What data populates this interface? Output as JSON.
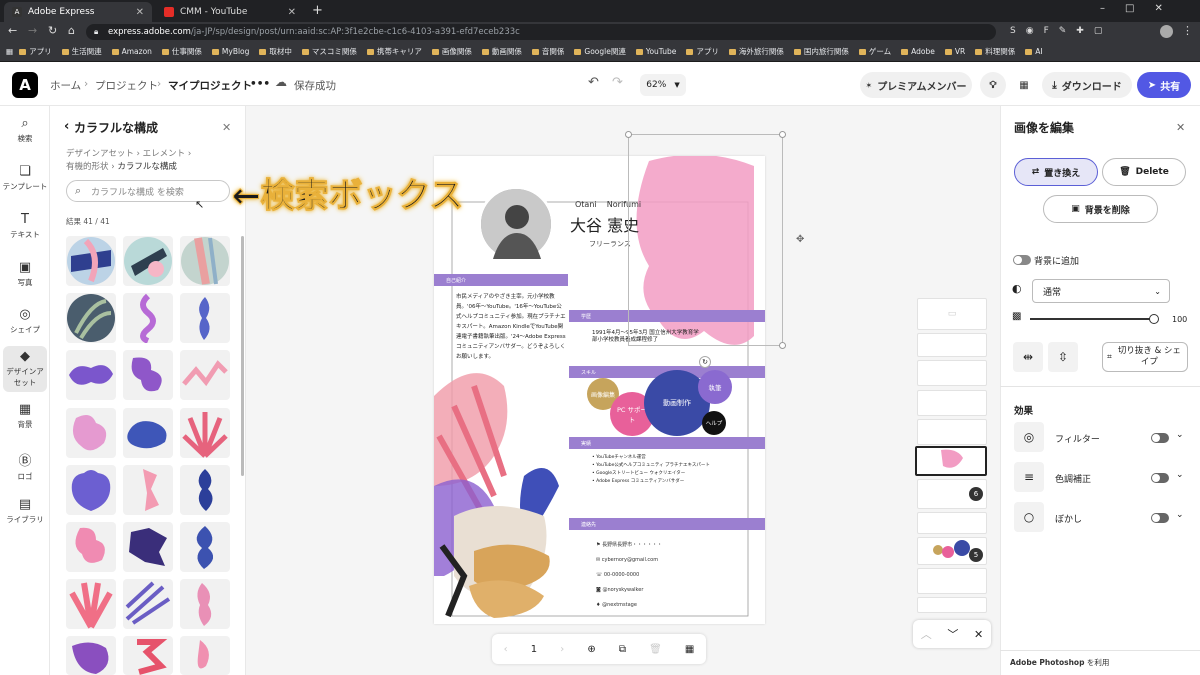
{
  "browser": {
    "tabs": [
      {
        "label": "Adobe Express",
        "active": true
      },
      {
        "label": "CMM - YouTube",
        "active": false
      }
    ],
    "url_host": "express.adobe.com",
    "url_path": "/ja-JP/sp/design/post/urn:aaid:sc:AP:3f1e2cbe-c1c6-4103-a391-efd7eceb233c",
    "bookmarks": [
      "アプリ",
      "生活関連",
      "Amazon",
      "仕事関係",
      "MyBlog",
      "取材中",
      "マスコミ関係",
      "携帯キャリア",
      "画像関係",
      "動画関係",
      "音関係",
      "Google関連",
      "YouTube",
      "アプリ",
      "海外旅行関係",
      "国内旅行関係",
      "ゲーム",
      "Adobe",
      "VR",
      "料理関係",
      "AI"
    ]
  },
  "header": {
    "logo": "A",
    "breadcrumb": [
      "ホーム",
      "プロジェクト",
      "マイプロジェクト"
    ],
    "more": "•••",
    "save_status": "保存成功",
    "zoom": "62%",
    "premium": "プレミアムメンバー",
    "download": "ダウンロード",
    "share": "共有"
  },
  "rail": [
    {
      "icon": "search-icon",
      "glyph": "⌕",
      "label": "検索"
    },
    {
      "icon": "template-icon",
      "glyph": "❏",
      "label": "テンプレート"
    },
    {
      "icon": "text-icon",
      "glyph": "T",
      "label": "テキスト"
    },
    {
      "icon": "photo-icon",
      "glyph": "▣",
      "label": "写真"
    },
    {
      "icon": "shape-icon",
      "glyph": "◎",
      "label": "シェイプ"
    },
    {
      "icon": "design-asset-icon",
      "glyph": "◆",
      "label": "デザインアセット"
    },
    {
      "icon": "background-icon",
      "glyph": "▦",
      "label": "背景"
    },
    {
      "icon": "logo-icon",
      "glyph": "Ⓑ",
      "label": "ロゴ"
    },
    {
      "icon": "library-icon",
      "glyph": "▤",
      "label": "ライブラリ"
    }
  ],
  "panel": {
    "title": "カラフルな構成",
    "crumb1": "デザインアセット",
    "crumb2": "エレメント",
    "crumb3": "有機的形状",
    "crumb4": "カラフルな構成",
    "search_placeholder": "カラフルな構成 を検索",
    "results": "結果 41 / 41"
  },
  "annotation": "←検索ボックス",
  "resume": {
    "name_roman": "Otani    Norifumi",
    "name_jp": "大谷 憲史",
    "title": "フリーランス",
    "section_intro": "自己紹介",
    "intro_text": "市民メディアのやざき主宰。元小学校教員。'06年〜YouTube。'16年〜YouTube公式ヘルプコミュニティ参加。現在プラチナエキスパート。Amazon KindleでYouTube関連電子書籍執筆出版。'24〜Adobe Express コミュニティアンバサダー。どうぞよろしくお願いします。",
    "section_school": "学歴",
    "school_text": "1991年4月〜95年3月 国立信州大学教育学部小学校教員養成課程修了",
    "section_skill": "スキル",
    "skills": [
      "画像編集",
      "PC サポート",
      "動画制作",
      "執筆",
      "ヘルプ"
    ],
    "section_works": "実績",
    "works": [
      "YouTubeチャンネル運営",
      "YouTube公式ヘルプコミュニティ プラチナエキスパート",
      "Googleストリートビュー ウォクリエイター",
      "Adobe Express コミュニティアンバサダー"
    ],
    "section_contact": "連絡先",
    "contacts": [
      "長野県長野市・・・・・・",
      "cybernory@gmail.com",
      "00-0000-0000",
      "@noryskywalker",
      "@nextmstage"
    ]
  },
  "pager": {
    "page": "1"
  },
  "right": {
    "title": "画像を編集",
    "replace": "置き換え",
    "delete": "Delete",
    "remove_bg": "背景を削除",
    "add_to_bg": "背景に追加",
    "blend": "通常",
    "opacity": "100",
    "crop": "切り抜き & シェイプ",
    "effects": "効果",
    "filter": "フィルター",
    "color": "色調補正",
    "blur": "ぼかし",
    "footer_brand": "Adobe Photoshop",
    "footer_suffix": " を利用"
  },
  "layers": {
    "badge1": "6",
    "badge2": "5"
  }
}
